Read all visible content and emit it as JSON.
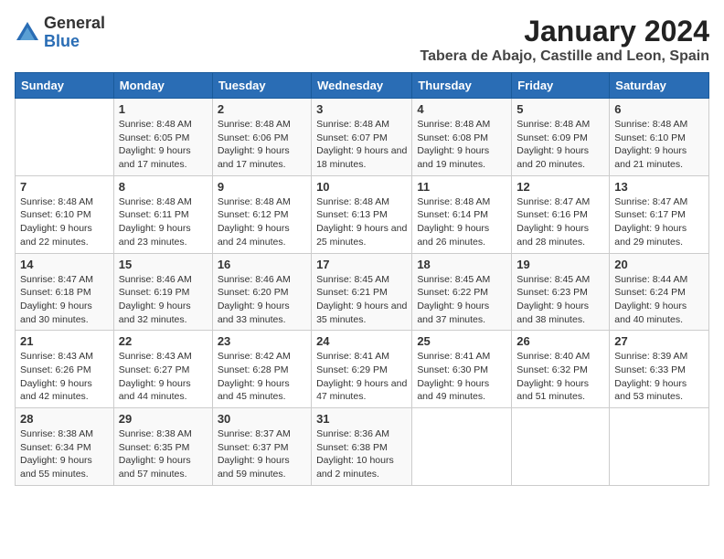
{
  "header": {
    "logo_general": "General",
    "logo_blue": "Blue",
    "month_title": "January 2024",
    "location": "Tabera de Abajo, Castille and Leon, Spain"
  },
  "days_of_week": [
    "Sunday",
    "Monday",
    "Tuesday",
    "Wednesday",
    "Thursday",
    "Friday",
    "Saturday"
  ],
  "weeks": [
    [
      {
        "day": "",
        "sunrise": "",
        "sunset": "",
        "daylight": ""
      },
      {
        "day": "1",
        "sunrise": "Sunrise: 8:48 AM",
        "sunset": "Sunset: 6:05 PM",
        "daylight": "Daylight: 9 hours and 17 minutes."
      },
      {
        "day": "2",
        "sunrise": "Sunrise: 8:48 AM",
        "sunset": "Sunset: 6:06 PM",
        "daylight": "Daylight: 9 hours and 17 minutes."
      },
      {
        "day": "3",
        "sunrise": "Sunrise: 8:48 AM",
        "sunset": "Sunset: 6:07 PM",
        "daylight": "Daylight: 9 hours and 18 minutes."
      },
      {
        "day": "4",
        "sunrise": "Sunrise: 8:48 AM",
        "sunset": "Sunset: 6:08 PM",
        "daylight": "Daylight: 9 hours and 19 minutes."
      },
      {
        "day": "5",
        "sunrise": "Sunrise: 8:48 AM",
        "sunset": "Sunset: 6:09 PM",
        "daylight": "Daylight: 9 hours and 20 minutes."
      },
      {
        "day": "6",
        "sunrise": "Sunrise: 8:48 AM",
        "sunset": "Sunset: 6:10 PM",
        "daylight": "Daylight: 9 hours and 21 minutes."
      }
    ],
    [
      {
        "day": "7",
        "sunrise": "Sunrise: 8:48 AM",
        "sunset": "Sunset: 6:10 PM",
        "daylight": "Daylight: 9 hours and 22 minutes."
      },
      {
        "day": "8",
        "sunrise": "Sunrise: 8:48 AM",
        "sunset": "Sunset: 6:11 PM",
        "daylight": "Daylight: 9 hours and 23 minutes."
      },
      {
        "day": "9",
        "sunrise": "Sunrise: 8:48 AM",
        "sunset": "Sunset: 6:12 PM",
        "daylight": "Daylight: 9 hours and 24 minutes."
      },
      {
        "day": "10",
        "sunrise": "Sunrise: 8:48 AM",
        "sunset": "Sunset: 6:13 PM",
        "daylight": "Daylight: 9 hours and 25 minutes."
      },
      {
        "day": "11",
        "sunrise": "Sunrise: 8:48 AM",
        "sunset": "Sunset: 6:14 PM",
        "daylight": "Daylight: 9 hours and 26 minutes."
      },
      {
        "day": "12",
        "sunrise": "Sunrise: 8:47 AM",
        "sunset": "Sunset: 6:16 PM",
        "daylight": "Daylight: 9 hours and 28 minutes."
      },
      {
        "day": "13",
        "sunrise": "Sunrise: 8:47 AM",
        "sunset": "Sunset: 6:17 PM",
        "daylight": "Daylight: 9 hours and 29 minutes."
      }
    ],
    [
      {
        "day": "14",
        "sunrise": "Sunrise: 8:47 AM",
        "sunset": "Sunset: 6:18 PM",
        "daylight": "Daylight: 9 hours and 30 minutes."
      },
      {
        "day": "15",
        "sunrise": "Sunrise: 8:46 AM",
        "sunset": "Sunset: 6:19 PM",
        "daylight": "Daylight: 9 hours and 32 minutes."
      },
      {
        "day": "16",
        "sunrise": "Sunrise: 8:46 AM",
        "sunset": "Sunset: 6:20 PM",
        "daylight": "Daylight: 9 hours and 33 minutes."
      },
      {
        "day": "17",
        "sunrise": "Sunrise: 8:45 AM",
        "sunset": "Sunset: 6:21 PM",
        "daylight": "Daylight: 9 hours and 35 minutes."
      },
      {
        "day": "18",
        "sunrise": "Sunrise: 8:45 AM",
        "sunset": "Sunset: 6:22 PM",
        "daylight": "Daylight: 9 hours and 37 minutes."
      },
      {
        "day": "19",
        "sunrise": "Sunrise: 8:45 AM",
        "sunset": "Sunset: 6:23 PM",
        "daylight": "Daylight: 9 hours and 38 minutes."
      },
      {
        "day": "20",
        "sunrise": "Sunrise: 8:44 AM",
        "sunset": "Sunset: 6:24 PM",
        "daylight": "Daylight: 9 hours and 40 minutes."
      }
    ],
    [
      {
        "day": "21",
        "sunrise": "Sunrise: 8:43 AM",
        "sunset": "Sunset: 6:26 PM",
        "daylight": "Daylight: 9 hours and 42 minutes."
      },
      {
        "day": "22",
        "sunrise": "Sunrise: 8:43 AM",
        "sunset": "Sunset: 6:27 PM",
        "daylight": "Daylight: 9 hours and 44 minutes."
      },
      {
        "day": "23",
        "sunrise": "Sunrise: 8:42 AM",
        "sunset": "Sunset: 6:28 PM",
        "daylight": "Daylight: 9 hours and 45 minutes."
      },
      {
        "day": "24",
        "sunrise": "Sunrise: 8:41 AM",
        "sunset": "Sunset: 6:29 PM",
        "daylight": "Daylight: 9 hours and 47 minutes."
      },
      {
        "day": "25",
        "sunrise": "Sunrise: 8:41 AM",
        "sunset": "Sunset: 6:30 PM",
        "daylight": "Daylight: 9 hours and 49 minutes."
      },
      {
        "day": "26",
        "sunrise": "Sunrise: 8:40 AM",
        "sunset": "Sunset: 6:32 PM",
        "daylight": "Daylight: 9 hours and 51 minutes."
      },
      {
        "day": "27",
        "sunrise": "Sunrise: 8:39 AM",
        "sunset": "Sunset: 6:33 PM",
        "daylight": "Daylight: 9 hours and 53 minutes."
      }
    ],
    [
      {
        "day": "28",
        "sunrise": "Sunrise: 8:38 AM",
        "sunset": "Sunset: 6:34 PM",
        "daylight": "Daylight: 9 hours and 55 minutes."
      },
      {
        "day": "29",
        "sunrise": "Sunrise: 8:38 AM",
        "sunset": "Sunset: 6:35 PM",
        "daylight": "Daylight: 9 hours and 57 minutes."
      },
      {
        "day": "30",
        "sunrise": "Sunrise: 8:37 AM",
        "sunset": "Sunset: 6:37 PM",
        "daylight": "Daylight: 9 hours and 59 minutes."
      },
      {
        "day": "31",
        "sunrise": "Sunrise: 8:36 AM",
        "sunset": "Sunset: 6:38 PM",
        "daylight": "Daylight: 10 hours and 2 minutes."
      },
      {
        "day": "",
        "sunrise": "",
        "sunset": "",
        "daylight": ""
      },
      {
        "day": "",
        "sunrise": "",
        "sunset": "",
        "daylight": ""
      },
      {
        "day": "",
        "sunrise": "",
        "sunset": "",
        "daylight": ""
      }
    ]
  ]
}
